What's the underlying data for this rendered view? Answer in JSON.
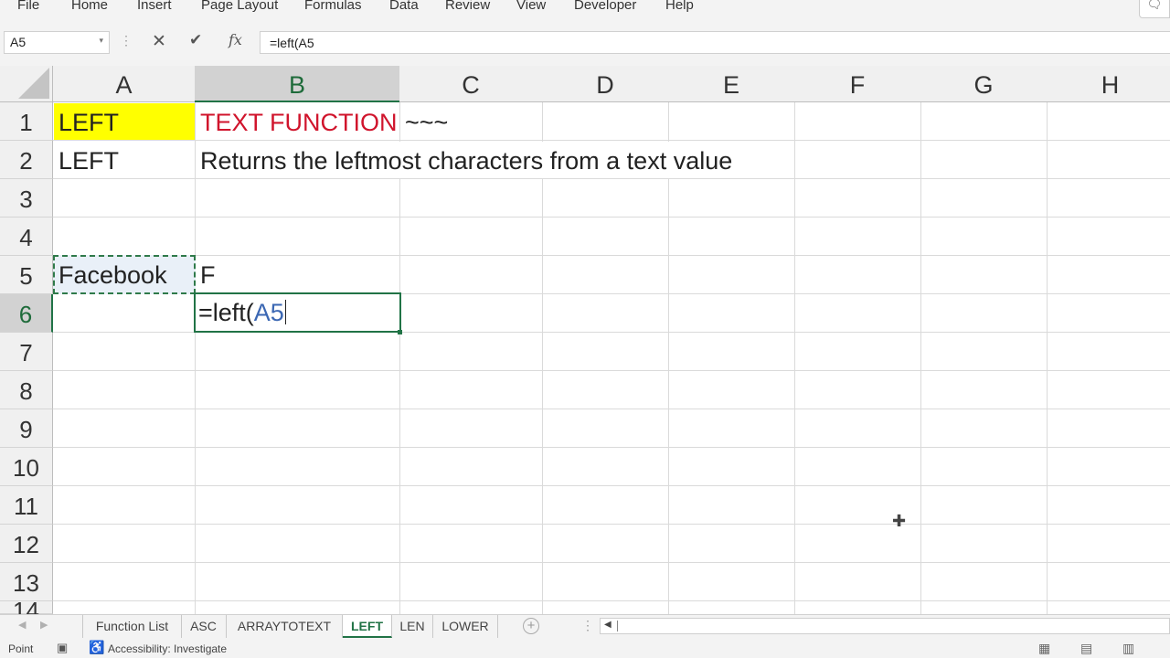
{
  "ribbon": {
    "tabs": [
      "File",
      "Home",
      "Insert",
      "Page Layout",
      "Formulas",
      "Data",
      "Review",
      "View",
      "Developer",
      "Help"
    ]
  },
  "formula_bar": {
    "name_box": "A5",
    "formula": "=left(A5"
  },
  "grid": {
    "columns": [
      "A",
      "B",
      "C",
      "D",
      "E",
      "F",
      "G",
      "H"
    ],
    "rows": [
      "1",
      "2",
      "3",
      "4",
      "5",
      "6",
      "7",
      "8",
      "9",
      "10",
      "11",
      "12",
      "13",
      "14"
    ],
    "cells": {
      "A1": "LEFT",
      "B1": "TEXT FUNCTION",
      "C1": "~~~",
      "A2": "LEFT",
      "B2": "Returns the leftmost characters from a text value",
      "A5": "Facebook",
      "B5": "F",
      "B6_prefix": "=left(",
      "B6_ref": "A5"
    },
    "highlight_color": "#ffff00",
    "title_color": "#d0142c",
    "accent_color": "#217346"
  },
  "sheet_tabs": [
    "Function List",
    "ASC",
    "ARRAYTOTEXT",
    "LEFT",
    "LEN",
    "LOWER"
  ],
  "active_sheet": "LEFT",
  "status_bar": {
    "mode": "Point",
    "accessibility": "Accessibility: Investigate"
  }
}
